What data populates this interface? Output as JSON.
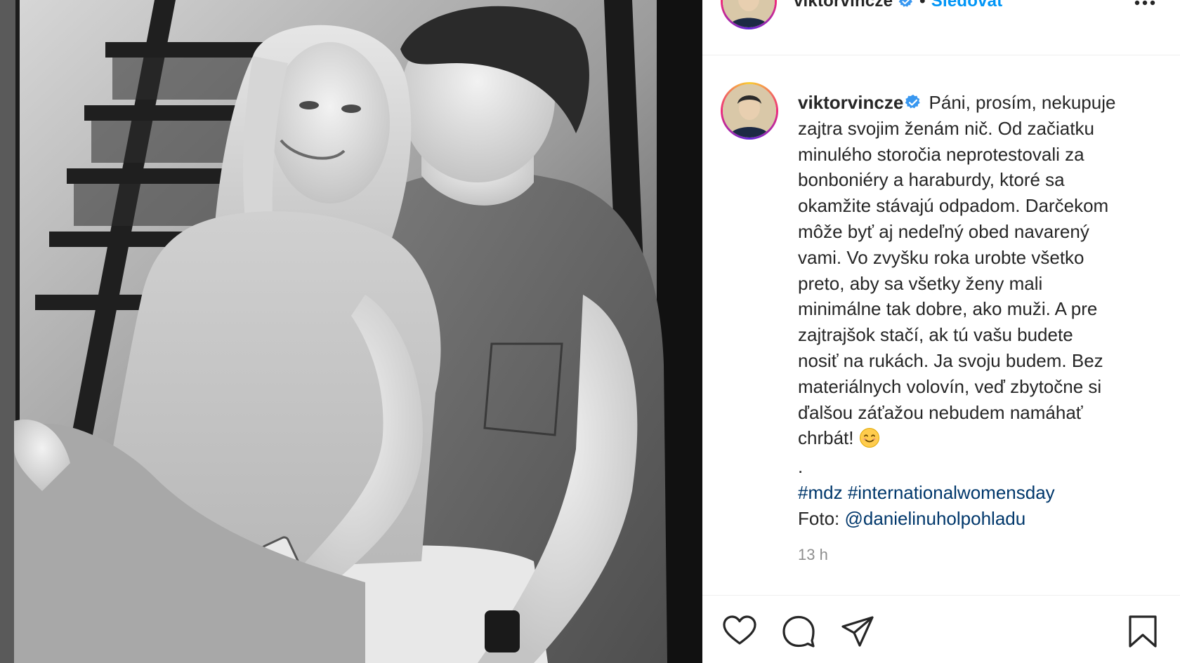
{
  "post": {
    "username": "viktorvincze",
    "separator": "•",
    "follow_label": "Sledovať",
    "caption_text_lines": [
      "Páni, prosím, nekupuje",
      "zajtra svojim ženám nič. Od začiatku",
      "minulého storočia neprotestovali za",
      "bonboniéry a haraburdy, ktoré sa",
      "okamžite stávajú odpadom. Darčekom",
      "môže byť aj nedeľný obed navarený",
      "vami. Vo zvyšku roka urobte všetko",
      "preto, aby sa všetky ženy mali",
      "minimálne tak dobre, ako muži. A pre",
      "zajtrajšok stačí, ak tú vašu budete",
      "nosiť na rukách. Ja svoju budem. Bez",
      "materiálnych volovín, veď zbytočne si",
      "ďalšou záťažou nebudem namáhať",
      "chrbát!"
    ],
    "dot": ".",
    "hashtag_1": "#mdz",
    "hashtag_2": "#internationalwomensday",
    "photo_prefix": "Foto:",
    "photo_credit": "@danielinuholpohladu",
    "timestamp": "13 h"
  },
  "icons": {
    "verified": "verified-badge-icon",
    "more": "more-options-icon",
    "emoji": "smiling-face-emoji-icon",
    "like": "heart-icon",
    "comment": "comment-bubble-icon",
    "share": "paper-plane-icon",
    "save": "bookmark-icon"
  },
  "colors": {
    "link": "#00376b",
    "follow": "#0095f6",
    "verified": "#3897f0",
    "text": "#262626",
    "muted": "#8e8e8e"
  }
}
